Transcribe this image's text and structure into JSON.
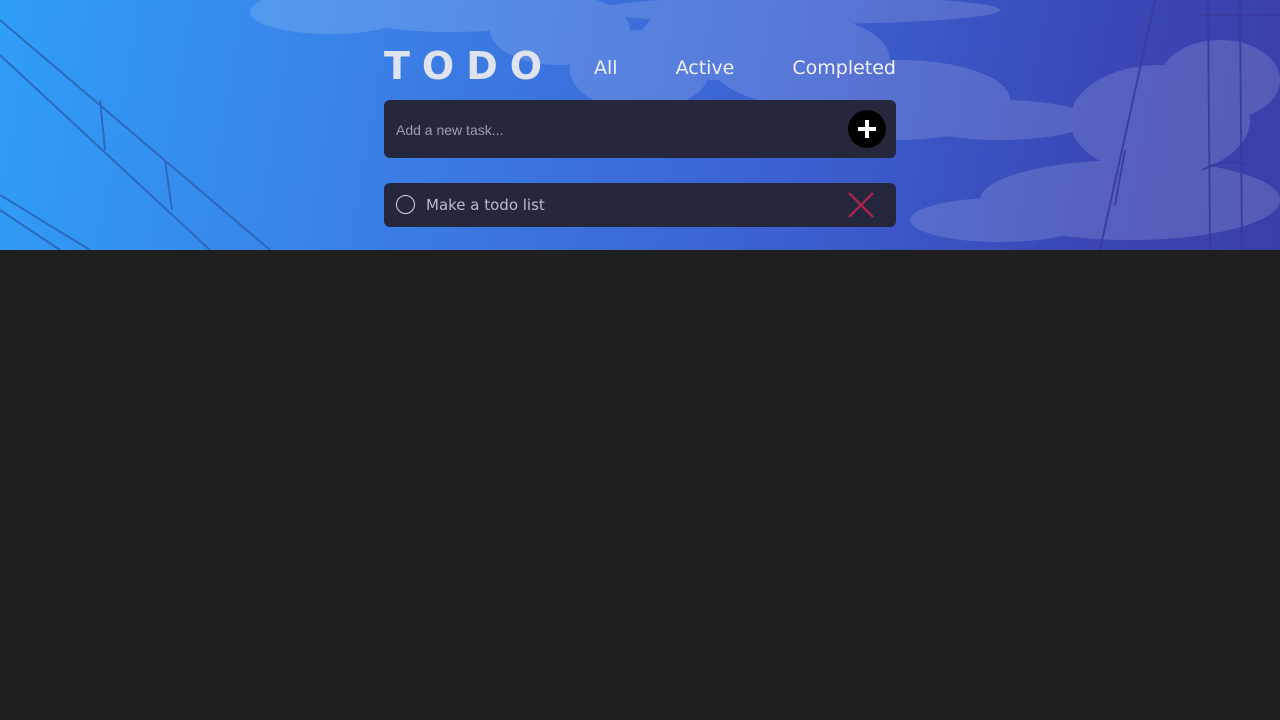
{
  "app": {
    "title": "TODO"
  },
  "filters": {
    "all": "All",
    "active": "Active",
    "completed": "Completed"
  },
  "new_task": {
    "placeholder": "Add a new task...",
    "value": "",
    "add_icon": "plus-icon"
  },
  "todos": [
    {
      "text": "Make a todo list",
      "completed": false,
      "check_icon": "circle-icon",
      "delete_icon": "close-icon"
    }
  ],
  "colors": {
    "background": "#1f1f1f",
    "card": "#25273c",
    "delete_accent": "#b3244a",
    "add_button": "#000000"
  }
}
